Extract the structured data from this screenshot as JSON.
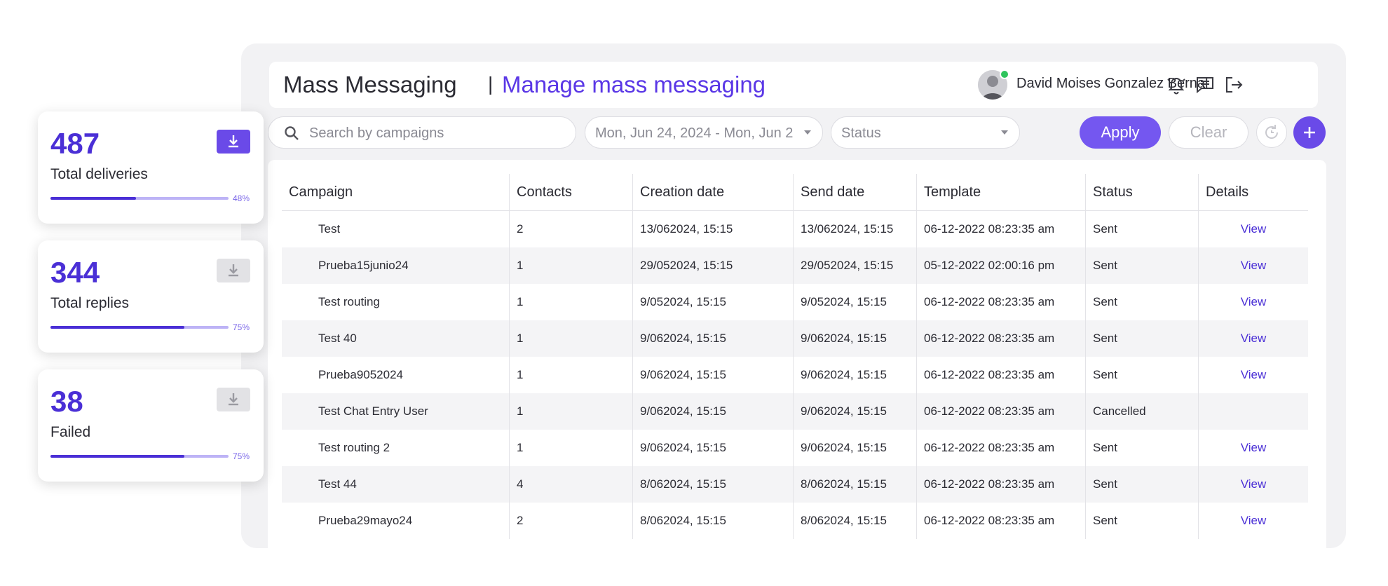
{
  "header": {
    "title": "Mass Messaging",
    "separator": "|",
    "subtitle": "Manage mass messaging",
    "user_name": "David Moises Gonzalez Bernal",
    "icons": [
      "bell-icon",
      "chat-icon",
      "logout-icon"
    ]
  },
  "toolbar": {
    "search_placeholder": "Search by campaigns",
    "date_range": "Mon, Jun 24, 2024 - Mon, Jun 2",
    "status_placeholder": "Status",
    "apply_label": "Apply",
    "clear_label": "Clear"
  },
  "table": {
    "columns": [
      "Campaign",
      "Contacts",
      "Creation date",
      "Send date",
      "Template",
      "Status",
      "Details"
    ],
    "rows": [
      {
        "campaign": "Test",
        "contacts": "2",
        "creation": "13/062024, 15:15",
        "send": "13/062024, 15:15",
        "template": "06-12-2022 08:23:35 am",
        "status": "Sent",
        "details": "View"
      },
      {
        "campaign": "Prueba15junio24",
        "contacts": "1",
        "creation": "29/052024, 15:15",
        "send": "29/052024, 15:15",
        "template": "05-12-2022 02:00:16 pm",
        "status": "Sent",
        "details": "View"
      },
      {
        "campaign": "Test routing",
        "contacts": "1",
        "creation": "9/052024, 15:15",
        "send": "9/052024, 15:15",
        "template": "06-12-2022 08:23:35 am",
        "status": "Sent",
        "details": "View"
      },
      {
        "campaign": "Test 40",
        "contacts": "1",
        "creation": "9/062024, 15:15",
        "send": "9/062024, 15:15",
        "template": "06-12-2022 08:23:35 am",
        "status": "Sent",
        "details": "View"
      },
      {
        "campaign": "Prueba9052024",
        "contacts": "1",
        "creation": "9/062024, 15:15",
        "send": "9/062024, 15:15",
        "template": "06-12-2022 08:23:35 am",
        "status": "Sent",
        "details": "View"
      },
      {
        "campaign": "Test Chat Entry User",
        "contacts": "1",
        "creation": "9/062024, 15:15",
        "send": "9/062024, 15:15",
        "template": "06-12-2022 08:23:35 am",
        "status": "Cancelled",
        "details": ""
      },
      {
        "campaign": "Test routing 2",
        "contacts": "1",
        "creation": "9/062024, 15:15",
        "send": "9/062024, 15:15",
        "template": "06-12-2022 08:23:35 am",
        "status": "Sent",
        "details": "View"
      },
      {
        "campaign": "Test 44",
        "contacts": "4",
        "creation": "8/062024, 15:15",
        "send": "8/062024, 15:15",
        "template": "06-12-2022 08:23:35 am",
        "status": "Sent",
        "details": "View"
      },
      {
        "campaign": "Prueba29mayo24",
        "contacts": "2",
        "creation": "8/062024, 15:15",
        "send": "8/062024, 15:15",
        "template": "06-12-2022 08:23:35 am",
        "status": "Sent",
        "details": "View"
      }
    ]
  },
  "stats": [
    {
      "value": "487",
      "label": "Total deliveries",
      "progress": 0.48,
      "pct": "48%",
      "download_active": true
    },
    {
      "value": "344",
      "label": "Total replies",
      "progress": 0.75,
      "pct": "75%",
      "download_active": false
    },
    {
      "value": "38",
      "label": "Failed",
      "progress": 0.75,
      "pct": "75%",
      "download_active": false
    }
  ],
  "colors": {
    "accent": "#5a37e6",
    "accent_dark": "#4a2fd6",
    "apply_bg": "#7457f0",
    "status_online": "#2ec45c"
  }
}
